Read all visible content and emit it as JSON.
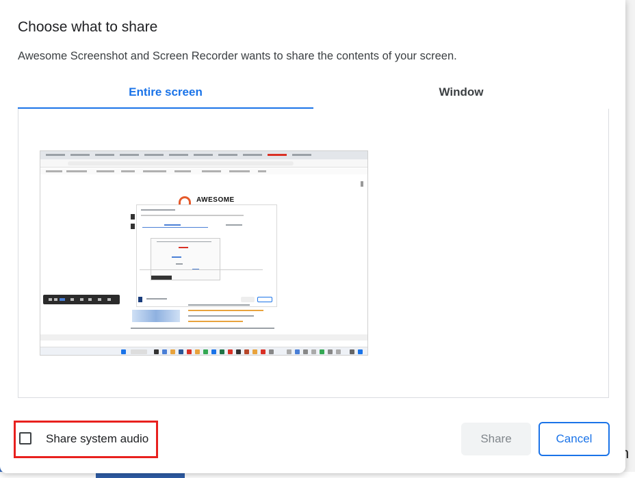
{
  "dialog": {
    "title": "Choose what to share",
    "subtitle": "Awesome Screenshot and Screen Recorder wants to share the contents of your screen."
  },
  "tabs": [
    {
      "label": "Entire screen",
      "active": true
    },
    {
      "label": "Window",
      "active": false
    }
  ],
  "preview": {
    "logo_text": "AWESOME"
  },
  "audio": {
    "label": "Share system audio",
    "checked": false
  },
  "buttons": {
    "share_label": "Share",
    "share_enabled": false,
    "cancel_label": "Cancel"
  },
  "background": {
    "partial_letter": "n"
  },
  "colors": {
    "accent": "#1a73e8",
    "highlight_box": "#e8201e",
    "disabled_bg": "#f1f3f4",
    "disabled_text": "#80868b"
  }
}
